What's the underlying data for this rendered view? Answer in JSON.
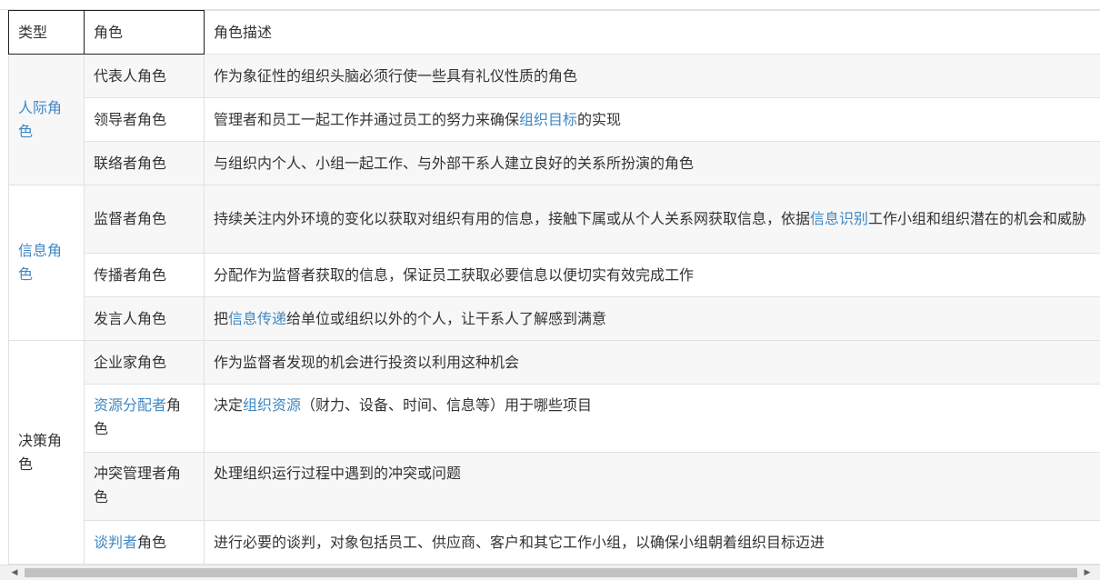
{
  "header": {
    "type": "类型",
    "role": "角色",
    "desc": "角色描述"
  },
  "groups": [
    {
      "category": "人际角色",
      "rows": [
        {
          "role": [
            {
              "t": "代表人角色"
            }
          ],
          "desc": [
            {
              "t": "作为象征性的组织头脑必须行使一些具有礼仪性质的角色"
            }
          ]
        },
        {
          "role": [
            {
              "t": "领导者角色"
            }
          ],
          "desc": [
            {
              "t": "管理者和员工一起工作并通过员工的努力来确保"
            },
            {
              "t": "组织目标",
              "link": true
            },
            {
              "t": "的实现"
            }
          ]
        },
        {
          "role": [
            {
              "t": "联络者角色"
            }
          ],
          "desc": [
            {
              "t": "与组织内个人、小组一起工作、与外部干系人建立良好的关系所扮演的角色"
            }
          ]
        }
      ]
    },
    {
      "category": "信息角色",
      "rows": [
        {
          "role": [
            {
              "t": "监督者角色"
            }
          ],
          "desc": [
            {
              "t": "持续关注内外环境的变化以获取对组织有用的信息，接触下属或从个人关系网获取信息，依据"
            },
            {
              "t": "信息识别",
              "link": true
            },
            {
              "t": "工作小组和组织潜在的机会和威胁"
            }
          ]
        },
        {
          "role": [
            {
              "t": "传播者角色"
            }
          ],
          "desc": [
            {
              "t": "分配作为监督者获取的信息，保证员工获取必要信息以便切实有效完成工作"
            }
          ]
        },
        {
          "role": [
            {
              "t": "发言人角色"
            }
          ],
          "desc": [
            {
              "t": "把"
            },
            {
              "t": "信息传递",
              "link": true
            },
            {
              "t": "给单位或组织以外的个人，让干系人了解感到满意"
            }
          ]
        }
      ]
    },
    {
      "category": "决策角色",
      "rows": [
        {
          "role": [
            {
              "t": "企业家角色"
            }
          ],
          "desc": [
            {
              "t": "作为监督者发现的机会进行投资以利用这种机会"
            }
          ]
        },
        {
          "role": [
            {
              "t": "资源分配者",
              "link": true
            },
            {
              "t": "角色"
            }
          ],
          "desc": [
            {
              "t": "决定"
            },
            {
              "t": "组织资源",
              "link": true
            },
            {
              "t": "（财力、设备、时间、信息等）用于哪些项目"
            }
          ]
        },
        {
          "role": [
            {
              "t": "冲突管理者角色"
            }
          ],
          "desc": [
            {
              "t": "处理组织运行过程中遇到的冲突或问题"
            }
          ]
        },
        {
          "role": [
            {
              "t": "谈判者",
              "link": true
            },
            {
              "t": "角色"
            }
          ],
          "desc": [
            {
              "t": "进行必要的谈判，对象包括员工、供应商、客户和其它工作小组，以确保小组朝着组织目标迈进"
            }
          ]
        }
      ]
    }
  ],
  "colors": {
    "link": "#3f88c5",
    "border": "#e1e1e1",
    "alt_row": "#f7f7f7"
  }
}
